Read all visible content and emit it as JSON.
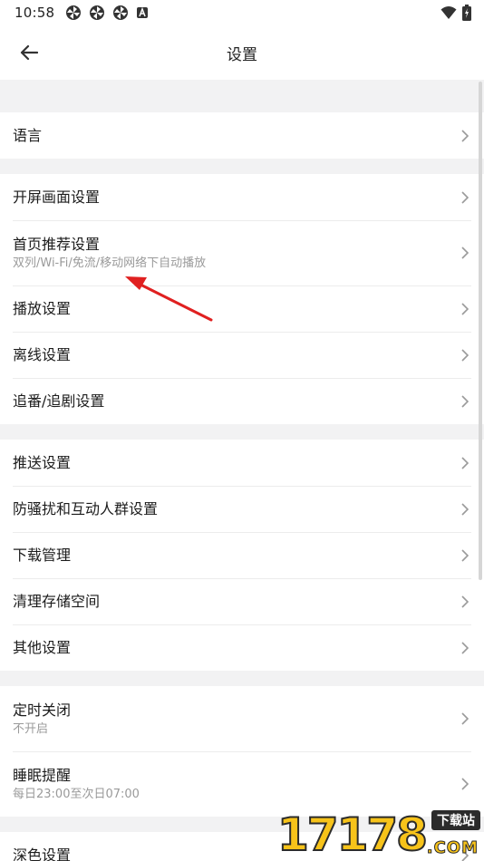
{
  "status_bar": {
    "time": "10:58",
    "left_icons": [
      "pinwheel-icon",
      "pinwheel-icon",
      "pinwheel-icon",
      "a-notification-icon"
    ],
    "right_icons": [
      "wifi-icon",
      "battery-charging-icon"
    ]
  },
  "app_bar": {
    "title": "设置",
    "back_icon": "back-arrow-icon"
  },
  "groups": [
    {
      "items": [
        {
          "label": "语言"
        }
      ]
    },
    {
      "items": [
        {
          "label": "开屏画面设置"
        },
        {
          "label": "首页推荐设置",
          "sub": "双列/Wi-Fi/免流/移动网络下自动播放"
        },
        {
          "label": "播放设置"
        },
        {
          "label": "离线设置"
        },
        {
          "label": "追番/追剧设置"
        }
      ]
    },
    {
      "items": [
        {
          "label": "推送设置"
        },
        {
          "label": "防骚扰和互动人群设置"
        },
        {
          "label": "下载管理"
        },
        {
          "label": "清理存储空间"
        },
        {
          "label": "其他设置"
        }
      ]
    },
    {
      "items": [
        {
          "label": "定时关闭",
          "sub": "不开启"
        },
        {
          "label": "睡眠提醒",
          "sub": "每日23:00至次日07:00"
        }
      ]
    },
    {
      "items": [
        {
          "label": "深色设置"
        }
      ]
    }
  ],
  "watermark": {
    "number": "17178",
    "badge": "下载站",
    "suffix": ".COM"
  },
  "colors": {
    "annotation_arrow": "#e02020",
    "chevron": "#9a9a9a",
    "watermark_yellow": "#f7c31a"
  }
}
